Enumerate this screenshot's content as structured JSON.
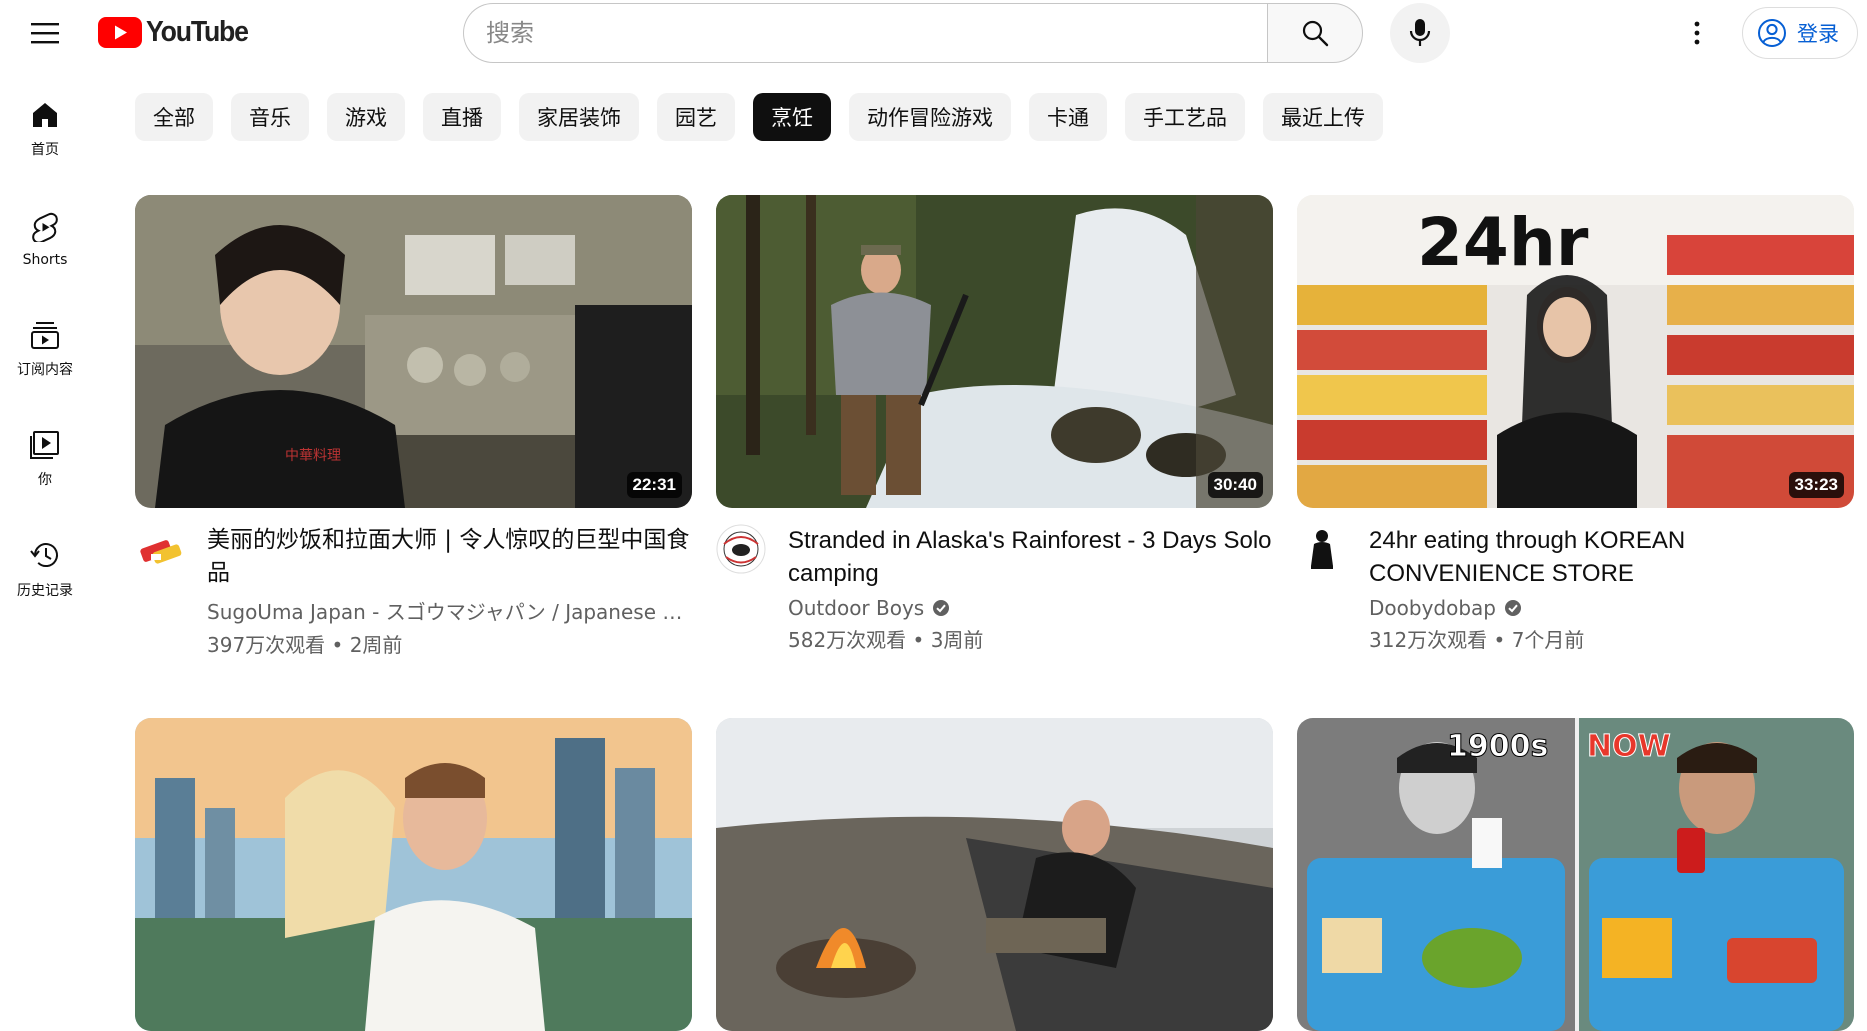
{
  "header": {
    "logo_text": "YouTube",
    "search_placeholder": "搜索",
    "signin_label": "登录"
  },
  "sidebar": {
    "items": [
      {
        "label": "首页",
        "icon": "home-icon"
      },
      {
        "label": "Shorts",
        "icon": "shorts-icon"
      },
      {
        "label": "订阅内容",
        "icon": "subscriptions-icon"
      },
      {
        "label": "你",
        "icon": "you-icon"
      },
      {
        "label": "历史记录",
        "icon": "history-icon"
      }
    ]
  },
  "chips": [
    "全部",
    "音乐",
    "游戏",
    "直播",
    "家居装饰",
    "园艺",
    "烹饪",
    "动作冒险游戏",
    "卡通",
    "手工艺品",
    "最近上传"
  ],
  "active_chip": "烹饪",
  "videos": [
    {
      "title": "美丽的炒饭和拉面大师 | 令人惊叹的巨型中国食品",
      "channel": "SugoUma Japan - スゴウマジャパン / Japanese Foods",
      "verified": false,
      "views": "397万次观看",
      "age": "2周前",
      "duration": "22:31"
    },
    {
      "title": "Stranded in Alaska's Rainforest - 3 Days Solo camping",
      "channel": "Outdoor Boys",
      "verified": true,
      "views": "582万次观看",
      "age": "3周前",
      "duration": "30:40"
    },
    {
      "title": "24hr eating through KOREAN CONVENIENCE STORE",
      "channel": "Doobydobap",
      "verified": true,
      "views": "312万次观看",
      "age": "7个月前",
      "duration": "33:23"
    },
    {
      "title": "",
      "channel": "",
      "verified": false,
      "views": "",
      "age": "",
      "duration": ""
    },
    {
      "title": "",
      "channel": "",
      "verified": false,
      "views": "",
      "age": "",
      "duration": ""
    },
    {
      "title": "",
      "channel": "",
      "verified": false,
      "views": "",
      "age": "",
      "duration": ""
    }
  ],
  "thumb_overlays": {
    "v3": "24hr",
    "v6_left": "1900s",
    "v6_right": "NOW"
  },
  "colors": {
    "brand_red": "#ff0000",
    "link_blue": "#065fd4",
    "text_secondary": "#606060",
    "chip_bg": "#f2f2f2",
    "chip_active_bg": "#0f0f0f"
  }
}
